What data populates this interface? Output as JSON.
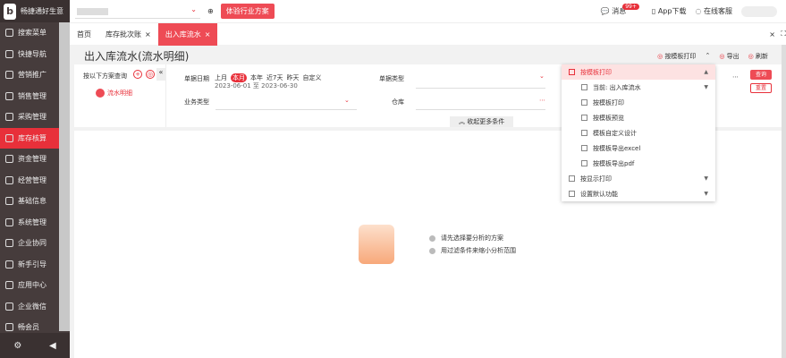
{
  "app": {
    "logo_text": "畅捷通好生意",
    "logo_sub": "b好生意"
  },
  "sidebar": {
    "items": [
      {
        "label": "搜索菜单"
      },
      {
        "label": "快捷导航"
      },
      {
        "label": "营销推广"
      },
      {
        "label": "销售管理"
      },
      {
        "label": "采购管理"
      },
      {
        "label": "库存核算",
        "active": true
      },
      {
        "label": "资金管理"
      },
      {
        "label": "经营管理"
      },
      {
        "label": "基础信息"
      },
      {
        "label": "系统管理"
      },
      {
        "label": "企业协同"
      },
      {
        "label": "新手引导"
      },
      {
        "label": "应用中心"
      },
      {
        "label": "企业微信"
      },
      {
        "label": "畅会员"
      }
    ]
  },
  "topbar": {
    "industry_button": "体验行业方案",
    "messages": "消息",
    "badge": "99+",
    "app_download": "App下载",
    "support": "在线客服"
  },
  "tabs": [
    {
      "label": "首页"
    },
    {
      "label": "库存批次账"
    },
    {
      "label": "出入库流水",
      "active": true
    }
  ],
  "page": {
    "title": "出入库流水(流水明细)",
    "print": "按模板打印",
    "export": "导出",
    "refresh": "刷新"
  },
  "left_panel": {
    "title": "按以下方案查询",
    "scheme": "流水明细"
  },
  "filters": {
    "date_label": "单据日期",
    "quick": [
      "上月",
      "本月",
      "本年",
      "近7天",
      "昨天",
      "自定义"
    ],
    "date_range": "2023-06-01 至 2023-06-30",
    "doc_type_label": "单据类型",
    "biz_type_label": "业务类型",
    "warehouse_label": "仓库",
    "more": "收起更多条件",
    "query": "查询",
    "reset": "重置"
  },
  "dropdown": {
    "head": "按模板打印",
    "current": "当前: 出入库流水",
    "items": [
      "按模板打印",
      "按模板预览",
      "模板自定义设计",
      "按模板导出excel",
      "按模板导出pdf"
    ],
    "display_print": "按显示打印",
    "default": "设置默认功能"
  },
  "empty": {
    "tip1": "请先选择要分析的方案",
    "tip2": "用过滤条件来缩小分析范围"
  },
  "colors": {
    "accent": "#e8303a",
    "sidebar": "#463c3c"
  }
}
